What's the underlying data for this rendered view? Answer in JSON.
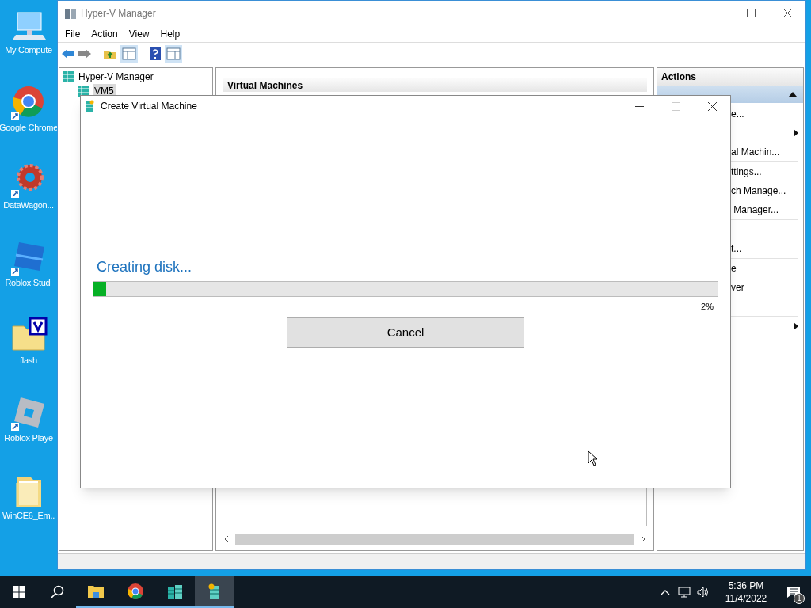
{
  "desktop_icons": [
    {
      "label": "My Compute",
      "kind": "computer"
    },
    {
      "label": "Google Chrome",
      "kind": "chrome"
    },
    {
      "label": "DataWagon...",
      "kind": "gear"
    },
    {
      "label": "Roblox Studi",
      "kind": "studio"
    },
    {
      "label": "flash",
      "kind": "folder_v"
    },
    {
      "label": "Roblox Playe",
      "kind": "player"
    },
    {
      "label": "WinCE6_Em..",
      "kind": "folder"
    }
  ],
  "hyperv_window": {
    "title": "Hyper-V Manager",
    "menu": [
      "File",
      "Action",
      "View",
      "Help"
    ],
    "tree": {
      "label": "Hyper-V Manager",
      "children": [
        {
          "label": "VM5",
          "selected": true
        }
      ]
    },
    "center_header": "Virtual Machines",
    "actions": {
      "header": "Actions",
      "expanded": true,
      "items": [
        {
          "kind": "item",
          "text": "e..."
        },
        {
          "kind": "item",
          "submenu": true
        },
        {
          "kind": "item",
          "text": "al Machin..."
        },
        {
          "kind": "separator"
        },
        {
          "kind": "item",
          "text": "ttings..."
        },
        {
          "kind": "item",
          "text": "ch Manage..."
        },
        {
          "kind": "item",
          "text": " Manager..."
        },
        {
          "kind": "separator"
        },
        {
          "kind": "item"
        },
        {
          "kind": "item",
          "text": "t..."
        },
        {
          "kind": "separator"
        },
        {
          "kind": "item",
          "text": "e"
        },
        {
          "kind": "item",
          "text": "ver"
        },
        {
          "kind": "item"
        },
        {
          "kind": "separator"
        },
        {
          "kind": "item",
          "submenu": true
        }
      ]
    }
  },
  "dialog": {
    "title": "Create Virtual Machine",
    "status": "Creating disk...",
    "level": 0.02,
    "percent": "2%",
    "button": "Cancel"
  },
  "taskbar": {
    "apps": [
      {
        "kind": "folder",
        "active": false
      },
      {
        "kind": "chrome",
        "active": false
      },
      {
        "kind": "servers",
        "active": false
      },
      {
        "kind": "vmconnect",
        "active": true
      }
    ],
    "time": "5:36 PM",
    "date": "11/4/2022",
    "notifications": "1"
  }
}
